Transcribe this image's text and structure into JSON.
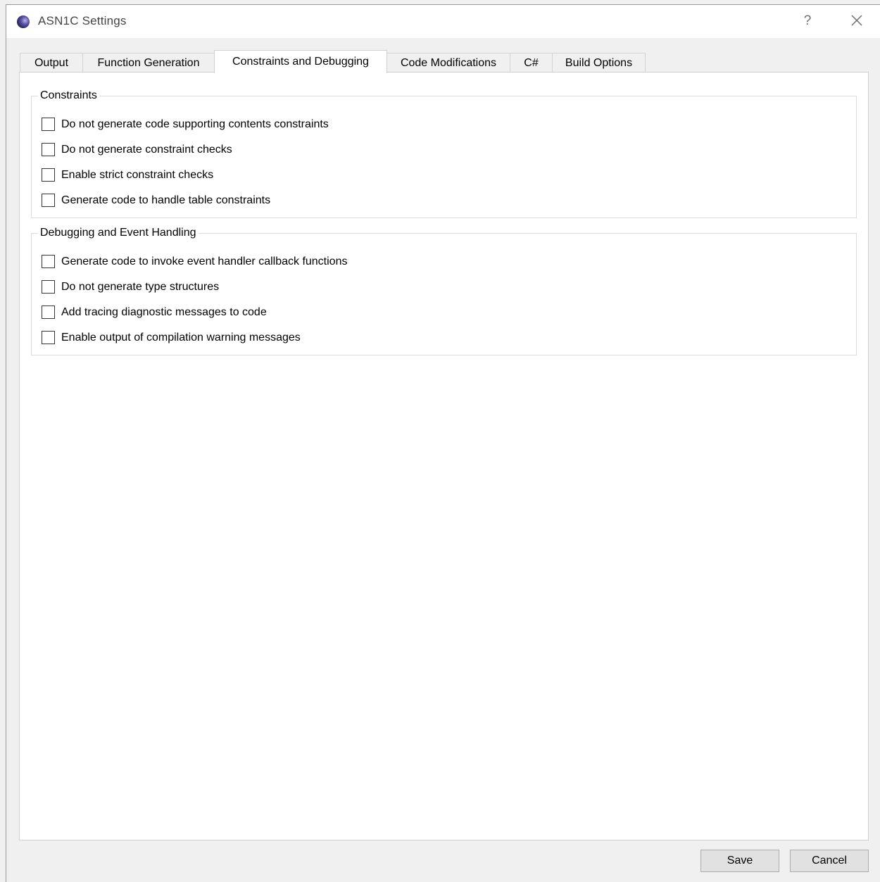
{
  "window": {
    "title": "ASN1C Settings",
    "help_label": "?",
    "icon": "eclipse-icon"
  },
  "tabs": [
    {
      "label": "Output",
      "active": false
    },
    {
      "label": "Function Generation",
      "active": false
    },
    {
      "label": "Constraints and Debugging",
      "active": true
    },
    {
      "label": "Code Modifications",
      "active": false
    },
    {
      "label": "C#",
      "active": false
    },
    {
      "label": "Build Options",
      "active": false
    }
  ],
  "groups": {
    "constraints": {
      "title": "Constraints",
      "options": [
        {
          "label": "Do not generate code supporting contents constraints",
          "checked": false
        },
        {
          "label": "Do not generate constraint checks",
          "checked": false
        },
        {
          "label": "Enable strict constraint checks",
          "checked": false
        },
        {
          "label": "Generate code to handle table constraints",
          "checked": false
        }
      ]
    },
    "debugging": {
      "title": "Debugging and Event Handling",
      "options": [
        {
          "label": "Generate code to invoke event handler callback functions",
          "checked": false
        },
        {
          "label": "Do not generate type structures",
          "checked": false
        },
        {
          "label": "Add tracing diagnostic messages to code",
          "checked": false
        },
        {
          "label": "Enable output of compilation warning messages",
          "checked": false
        }
      ]
    }
  },
  "buttons": {
    "save_label": "Save",
    "cancel_label": "Cancel"
  }
}
